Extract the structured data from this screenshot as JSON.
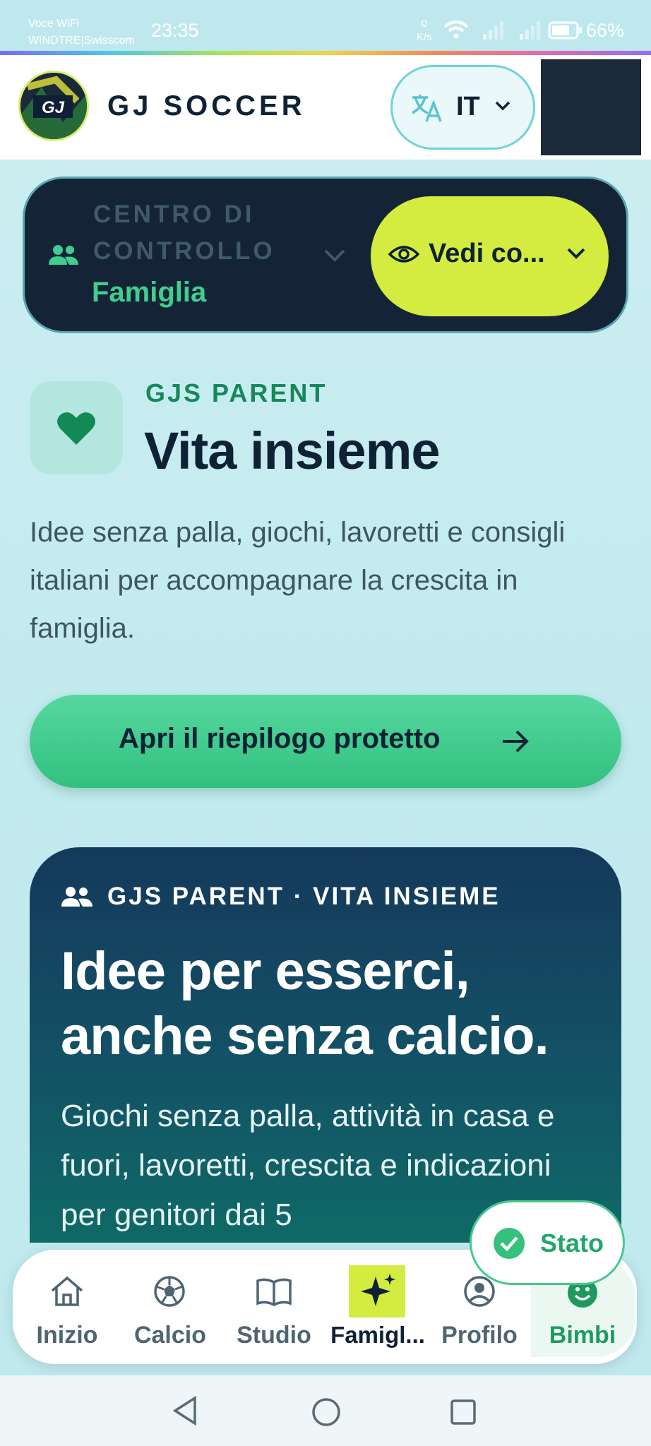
{
  "status_bar": {
    "carrier_line1": "Voce WiFi",
    "carrier_line2": "WINDTRE|Swisscom",
    "time": "23:35",
    "net_speed_value": "0",
    "net_speed_unit": "K/s",
    "battery": "66%"
  },
  "header": {
    "brand": "GJ SOCCER",
    "language": "IT"
  },
  "control_center": {
    "label": "CENTRO DI CONTROLLO",
    "value": "Famiglia",
    "view_button": "Vedi co..."
  },
  "intro": {
    "eyebrow": "GJS PARENT",
    "title": "Vita insieme",
    "description": "Idee senza palla, giochi, lavoretti e consigli italiani per accompagnare la crescita in famiglia.",
    "cta": "Apri il riepilogo protetto"
  },
  "card": {
    "eyebrow": "GJS PARENT · VITA INSIEME",
    "title": "Idee per esserci, anche senza calcio.",
    "description": "Giochi senza palla, attività in casa e fuori, lavoretti, crescita e indicazioni per genitori dai 5"
  },
  "status_pill": {
    "label": "Stato"
  },
  "bottom_nav": {
    "items": [
      {
        "label": "Inizio",
        "icon": "home-icon"
      },
      {
        "label": "Calcio",
        "icon": "soccer-ball-icon"
      },
      {
        "label": "Studio",
        "icon": "book-icon"
      },
      {
        "label": "Famigl...",
        "icon": "sparkles-icon",
        "active": true
      },
      {
        "label": "Profilo",
        "icon": "user-circle-icon"
      },
      {
        "label": "Bimbi",
        "icon": "smile-icon"
      }
    ]
  },
  "colors": {
    "accent_lime": "#d4ec3f",
    "accent_green": "#3fce8f",
    "navy": "#152336"
  }
}
